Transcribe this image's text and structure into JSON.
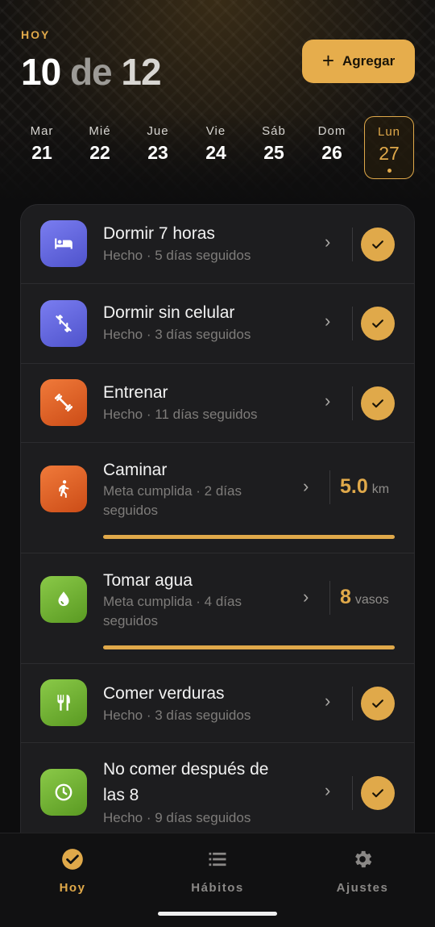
{
  "header": {
    "today_label": "HOY",
    "date_day": "10",
    "date_de": " de ",
    "date_month": "12",
    "add_button": "Agregar",
    "add_icon": "plus-icon",
    "accent_color": "#e6ad4c"
  },
  "week": [
    {
      "name": "Mar",
      "num": "21",
      "selected": false
    },
    {
      "name": "Mié",
      "num": "22",
      "selected": false
    },
    {
      "name": "Jue",
      "num": "23",
      "selected": false
    },
    {
      "name": "Vie",
      "num": "24",
      "selected": false
    },
    {
      "name": "Sáb",
      "num": "25",
      "selected": false
    },
    {
      "name": "Dom",
      "num": "26",
      "selected": false
    },
    {
      "name": "Lun",
      "num": "27",
      "selected": true
    }
  ],
  "habits": [
    {
      "title": "Dormir 7 horas",
      "subtitle": "Hecho · 5 días seguidos",
      "icon": "bed-icon",
      "color": "purple",
      "status": "done"
    },
    {
      "title": "Dormir sin celular",
      "subtitle": "Hecho · 3 días seguidos",
      "icon": "phone-off-icon",
      "color": "purple",
      "status": "done"
    },
    {
      "title": "Entrenar",
      "subtitle": "Hecho · 11 días seguidos",
      "icon": "dumbbell-icon",
      "color": "orange",
      "status": "done"
    },
    {
      "title": "Caminar",
      "subtitle_line1": "Meta cumplida · 2 días",
      "subtitle_line2": "seguidos",
      "icon": "walking-icon",
      "color": "orange",
      "value": "5.0",
      "unit": "km",
      "progress": 1.0
    },
    {
      "title": "Tomar agua",
      "subtitle_line1": "Meta cumplida · 4 días",
      "subtitle_line2": "seguidos",
      "icon": "water-drop-icon",
      "color": "green",
      "value": "8",
      "unit": "vasos",
      "progress": 1.0
    },
    {
      "title": "Comer verduras",
      "subtitle": "Hecho · 3 días seguidos",
      "icon": "utensils-icon",
      "color": "green",
      "status": "done"
    },
    {
      "title_line1": "No comer después de",
      "title_line2": "las 8",
      "subtitle": "Hecho · 9 días seguidos",
      "icon": "clock-icon",
      "color": "green",
      "status": "done"
    }
  ],
  "nav": {
    "items": [
      {
        "label": "Hoy",
        "icon": "check-circle-icon",
        "active": true
      },
      {
        "label": "Hábitos",
        "icon": "list-icon",
        "active": false
      },
      {
        "label": "Ajustes",
        "icon": "gear-icon",
        "active": false
      }
    ],
    "active_color": "#e0a94a",
    "inactive_color": "#8a8886"
  }
}
